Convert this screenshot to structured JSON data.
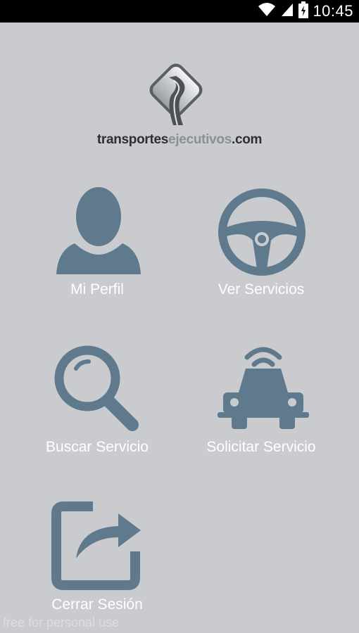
{
  "status_bar": {
    "time": "10:45",
    "icons": [
      "wifi-icon",
      "cell-signal-icon",
      "battery-charging-icon"
    ]
  },
  "logo": {
    "text_primary": "transportes",
    "text_accent": "ejecutivos",
    "text_suffix": ".com"
  },
  "menu": {
    "items": [
      {
        "label": "Mi Perfil",
        "icon": "user-icon"
      },
      {
        "label": "Ver Servicios",
        "icon": "steering-wheel-icon"
      },
      {
        "label": "Buscar Servicio",
        "icon": "search-icon"
      },
      {
        "label": "Solicitar Servicio",
        "icon": "car-signal-icon"
      },
      {
        "label": "Cerrar Sesión",
        "icon": "share-exit-icon"
      }
    ]
  },
  "watermark": "free for personal use",
  "colors": {
    "background": "#c9cbcf",
    "icon": "#5f7a8c",
    "label": "#ffffff",
    "status_bar": "#000000"
  }
}
